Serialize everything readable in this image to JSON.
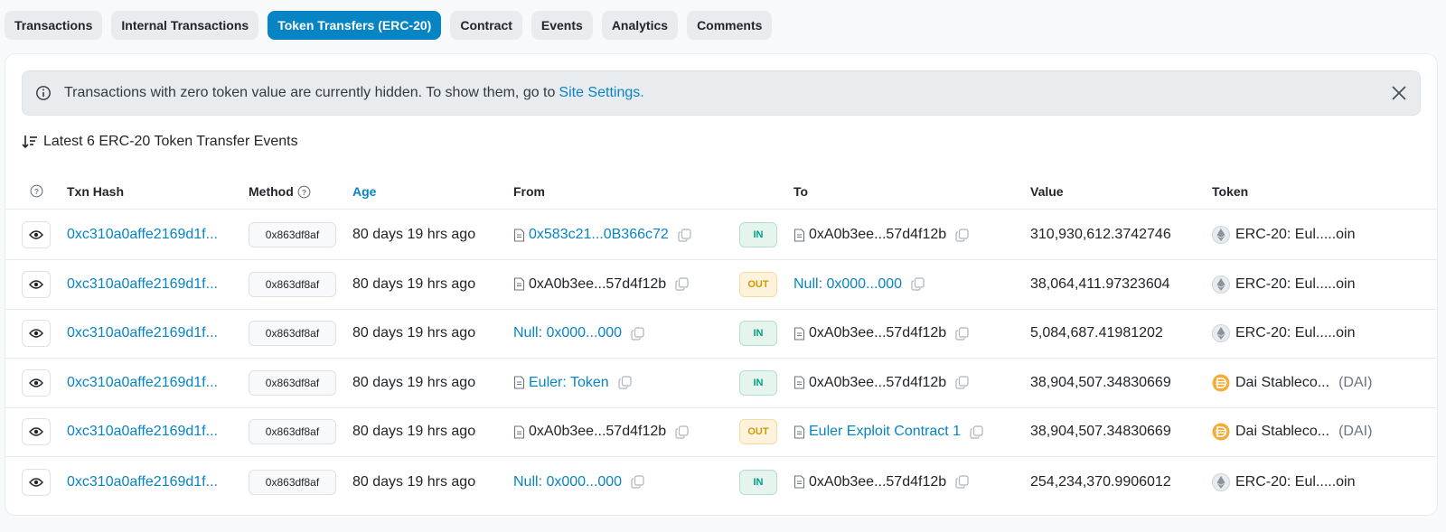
{
  "tabs": [
    {
      "label": "Transactions",
      "active": false
    },
    {
      "label": "Internal Transactions",
      "active": false
    },
    {
      "label": "Token Transfers (ERC-20)",
      "active": true
    },
    {
      "label": "Contract",
      "active": false
    },
    {
      "label": "Events",
      "active": false
    },
    {
      "label": "Analytics",
      "active": false
    },
    {
      "label": "Comments",
      "active": false
    }
  ],
  "alert": {
    "text": "Transactions with zero token value are currently hidden. To show them, go to",
    "link": "Site Settings."
  },
  "heading": "Latest 6 ERC-20 Token Transfer Events",
  "columns": {
    "txn_hash": "Txn Hash",
    "method": "Method",
    "age": "Age",
    "from": "From",
    "to": "To",
    "value": "Value",
    "token": "Token"
  },
  "colors": {
    "accent": "#0784c3",
    "in": "#00a186",
    "out": "#cc9a06"
  },
  "rows": [
    {
      "hash": "0xc310a0affe2169d1f...",
      "method": "0x863df8af",
      "age": "80 days 19 hrs ago",
      "from": "0x583c21...0B366c72",
      "from_link": true,
      "from_doc": true,
      "dir": "IN",
      "to": "0xA0b3ee...57d4f12b",
      "to_link": false,
      "to_doc": true,
      "value": "310,930,612.3742746",
      "token": "ERC-20: Eul.....oin",
      "token_symbol": "",
      "token_icon": "eth"
    },
    {
      "hash": "0xc310a0affe2169d1f...",
      "method": "0x863df8af",
      "age": "80 days 19 hrs ago",
      "from": "0xA0b3ee...57d4f12b",
      "from_link": false,
      "from_doc": true,
      "dir": "OUT",
      "to": "Null: 0x000...000",
      "to_link": true,
      "to_doc": false,
      "value": "38,064,411.97323604",
      "token": "ERC-20: Eul.....oin",
      "token_symbol": "",
      "token_icon": "eth"
    },
    {
      "hash": "0xc310a0affe2169d1f...",
      "method": "0x863df8af",
      "age": "80 days 19 hrs ago",
      "from": "Null: 0x000...000",
      "from_link": true,
      "from_doc": false,
      "dir": "IN",
      "to": "0xA0b3ee...57d4f12b",
      "to_link": false,
      "to_doc": true,
      "value": "5,084,687.41981202",
      "token": "ERC-20: Eul.....oin",
      "token_symbol": "",
      "token_icon": "eth"
    },
    {
      "hash": "0xc310a0affe2169d1f...",
      "method": "0x863df8af",
      "age": "80 days 19 hrs ago",
      "from": "Euler: Token",
      "from_link": true,
      "from_doc": true,
      "dir": "IN",
      "to": "0xA0b3ee...57d4f12b",
      "to_link": false,
      "to_doc": true,
      "value": "38,904,507.34830669",
      "token": "Dai Stableco...",
      "token_symbol": "(DAI)",
      "token_icon": "dai"
    },
    {
      "hash": "0xc310a0affe2169d1f...",
      "method": "0x863df8af",
      "age": "80 days 19 hrs ago",
      "from": "0xA0b3ee...57d4f12b",
      "from_link": false,
      "from_doc": true,
      "dir": "OUT",
      "to": "Euler Exploit Contract 1",
      "to_link": true,
      "to_doc": true,
      "value": "38,904,507.34830669",
      "token": "Dai Stableco...",
      "token_symbol": "(DAI)",
      "token_icon": "dai"
    },
    {
      "hash": "0xc310a0affe2169d1f...",
      "method": "0x863df8af",
      "age": "80 days 19 hrs ago",
      "from": "Null: 0x000...000",
      "from_link": true,
      "from_doc": false,
      "dir": "IN",
      "to": "0xA0b3ee...57d4f12b",
      "to_link": false,
      "to_doc": true,
      "value": "254,234,370.9906012",
      "token": "ERC-20: Eul.....oin",
      "token_symbol": "",
      "token_icon": "eth"
    }
  ]
}
